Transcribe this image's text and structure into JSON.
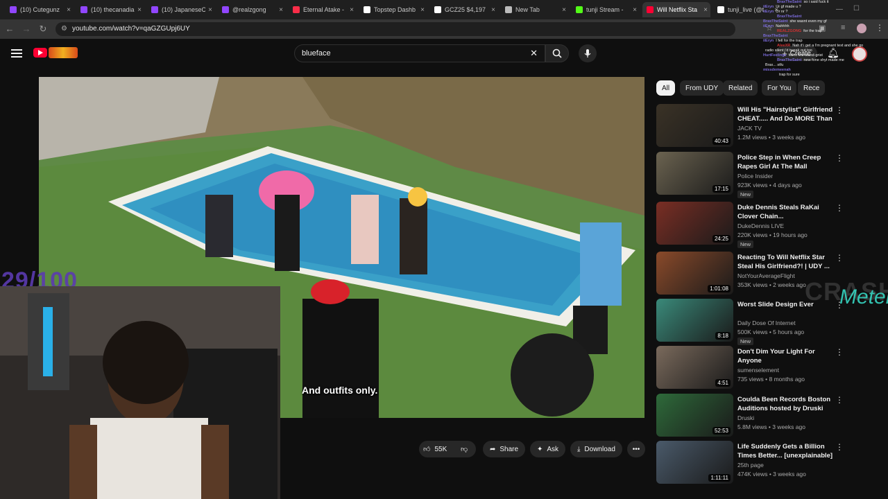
{
  "tabs": [
    {
      "label": "(10) Cutegunz",
      "color": "#9146ff"
    },
    {
      "label": "(10) thecanadia",
      "color": "#9146ff"
    },
    {
      "label": "(10) JapaneseC",
      "color": "#9146ff"
    },
    {
      "label": "@realzgong",
      "color": "#9146ff"
    },
    {
      "label": "Eternal Atake -",
      "color": "#fa2d48"
    },
    {
      "label": "Topstep Dashb",
      "color": "#ffffff"
    },
    {
      "label": "GCZ25 $4,197",
      "color": "#ffffff"
    },
    {
      "label": "New Tab",
      "color": "#bbbbbb"
    },
    {
      "label": "tunji Stream -",
      "color": "#53fc18"
    },
    {
      "label": "Will Netflix Sta",
      "color": "#ff0033"
    },
    {
      "label": "tunji_live (@t",
      "color": "#ffffff"
    }
  ],
  "address": {
    "url": "youtube.com/watch?v=qaGZGUpj6UY"
  },
  "search": {
    "query": "blueface"
  },
  "header": {
    "create_label": "Create"
  },
  "video": {
    "caption": "And outfits only.",
    "overlay_count": "29/100"
  },
  "actions": {
    "like_count": "55K",
    "share_label": "Share",
    "ask_label": "Ask",
    "download_label": "Download"
  },
  "chips": [
    "All",
    "From UDY",
    "Related",
    "For You",
    "Rece"
  ],
  "recommendations": [
    {
      "title": "Will His \"Hairstylist\" Girlfriend CHEAT..... And Do MORE Than ...",
      "channel": "JACK TV",
      "meta": "1.2M views • 3 weeks ago",
      "duration": "40:43",
      "is_new": false,
      "thumb_color": "#3a3226"
    },
    {
      "title": "Police Step in When Creep Rapes Girl At The Mall",
      "channel": "Police Insider",
      "meta": "923K views • 4 days ago",
      "duration": "17:15",
      "is_new": true,
      "thumb_color": "#6b6350"
    },
    {
      "title": "Duke Dennis Steals RaKai Clover Chain...",
      "channel": "DukeDennis LIVE",
      "meta": "220K views • 19 hours ago",
      "duration": "24:25",
      "is_new": true,
      "thumb_color": "#7a2e24"
    },
    {
      "title": "Reacting To Will Netflix Star Steal His Girlfriend?! | UDY ...",
      "channel": "NotYourAverageFlight",
      "meta": "353K views • 2 weeks ago",
      "duration": "1:01:08",
      "is_new": false,
      "thumb_color": "#8a4a2a"
    },
    {
      "title": "Worst Slide Design Ever",
      "channel": "Daily Dose Of Internet",
      "meta": "500K views • 5 hours ago",
      "duration": "8:18",
      "is_new": true,
      "thumb_color": "#3a8a7a"
    },
    {
      "title": "Don't Dim Your Light For Anyone",
      "channel": "sumenselement",
      "meta": "735 views • 8 months ago",
      "duration": "4:51",
      "is_new": false,
      "thumb_color": "#7a6a5c"
    },
    {
      "title": "Coulda Been Records Boston Auditions hosted by Druski",
      "channel": "Druski",
      "meta": "5.8M views • 3 weeks ago",
      "duration": "52:53",
      "is_new": false,
      "thumb_color": "#2e6a3a"
    },
    {
      "title": "Life Suddenly Gets a Billion Times Better... [unexplainable]",
      "channel": "25th page",
      "meta": "474K views • 3 weeks ago",
      "duration": "1:11:11",
      "is_new": false,
      "thumb_color": "#4a5a6a"
    }
  ],
  "chat": [
    {
      "user": "BraxTheSaint",
      "msg": "so i said fuck it",
      "red": false
    },
    {
      "user": "iiEryn",
      "msg": "Ur gf made u ?",
      "red": false
    },
    {
      "user": "iiEryn",
      "msg": "Or nr ?",
      "red": false
    },
    {
      "user": "BraxTheSaint",
      "msg": "",
      "red": false
    },
    {
      "user": "BraxTheSaint",
      "msg": "she wasnt even my gf",
      "red": false
    },
    {
      "user": "iiEryn",
      "msg": "Nahhhh",
      "red": false
    },
    {
      "user": "REALZGONG",
      "msg": "for the trap",
      "red": true
    },
    {
      "user": "BraxTheSaint",
      "msg": "",
      "red": false
    },
    {
      "user": "iiEryn",
      "msg": "I fell for the trap",
      "red": false
    },
    {
      "user": "AleeXR",
      "msg": "Nah if i get a I'm pregnant text and she go",
      "red": true
    },
    {
      "user": "",
      "msg": "radio silent i'd tweak out too",
      "red": false
    },
    {
      "user": "HurtFeelings",
      "msg": "fell in the stand-grist",
      "red": false
    },
    {
      "user": "BraxTheSaint",
      "msg": "new fone shyt made me",
      "red": false
    },
    {
      "user": "",
      "msg": "Brax... stfu",
      "red": false
    },
    {
      "user": "missdemeenah",
      "msg": "",
      "red": false
    },
    {
      "user": "",
      "msg": "trap for sure",
      "red": false
    }
  ],
  "overlays": {
    "crash": "CRASH",
    "meter": "Meter"
  },
  "colors": {
    "accent": "#ff0033",
    "bg": "#0f0f0f",
    "chip_bg": "#272727"
  }
}
